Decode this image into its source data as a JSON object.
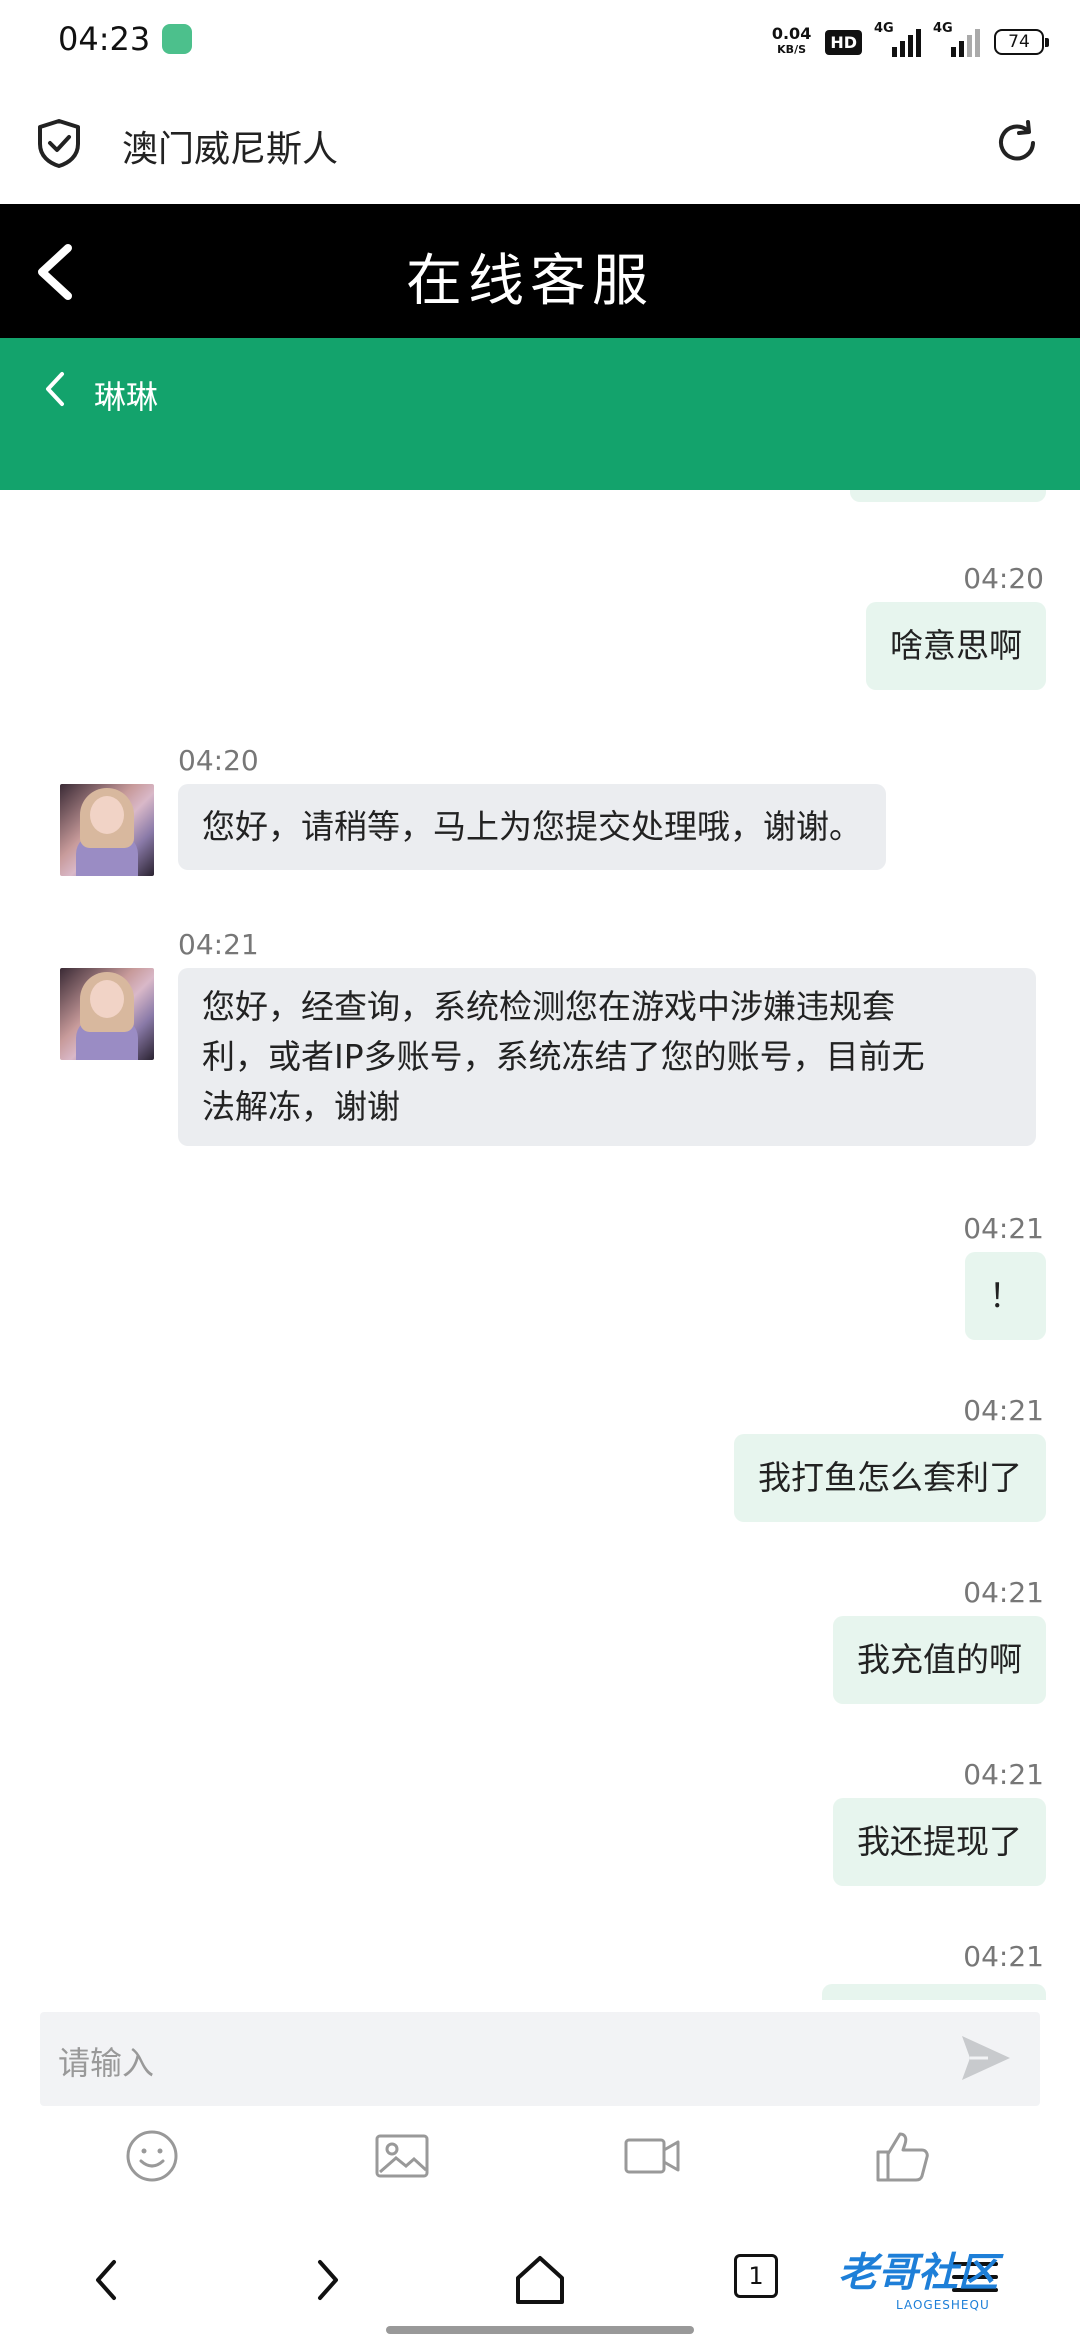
{
  "status_bar": {
    "time": "04:23",
    "net_speed_value": "0.04",
    "net_speed_unit": "KB/S",
    "hd_badge": "HD",
    "sim1_label": "4G",
    "sim2_label": "4G",
    "battery": "74"
  },
  "browser": {
    "site_title": "澳门威尼斯人"
  },
  "header": {
    "title": "在线客服"
  },
  "chat_header": {
    "agent_name": "琳琳"
  },
  "messages": [
    {
      "side": "out",
      "time": "04:20",
      "text": "啥意思啊"
    },
    {
      "side": "in",
      "time": "04:20",
      "text": "您好，请稍等，马上为您提交处理哦，谢谢。"
    },
    {
      "side": "in",
      "time": "04:21",
      "lines": [
        "您好，经查询，系统检测您在游戏中涉嫌违规套",
        "利，或者IP多账号，系统冻结了您的账号，目前无",
        "法解冻，谢谢"
      ]
    },
    {
      "side": "out",
      "time": "04:21",
      "text": "！"
    },
    {
      "side": "out",
      "time": "04:21",
      "text": "我打鱼怎么套利了"
    },
    {
      "side": "out",
      "time": "04:21",
      "text": "我充值的啊"
    },
    {
      "side": "out",
      "time": "04:21",
      "text": "我还提现了"
    },
    {
      "side": "out",
      "time": "04:21",
      "text": ""
    }
  ],
  "input": {
    "placeholder": "请输入"
  },
  "toolbar": [
    "emoji-icon",
    "image-icon",
    "video-icon",
    "thumbs-up-icon"
  ],
  "nav": {
    "tab_count": "1"
  },
  "watermark": {
    "text": "老哥社区",
    "sub": "LAOGESHEQU"
  },
  "colors": {
    "header_black": "#000000",
    "chat_header_green": "#13a36c",
    "outgoing_bubble": "#e7f5ee",
    "incoming_bubble": "#ebedf0"
  }
}
